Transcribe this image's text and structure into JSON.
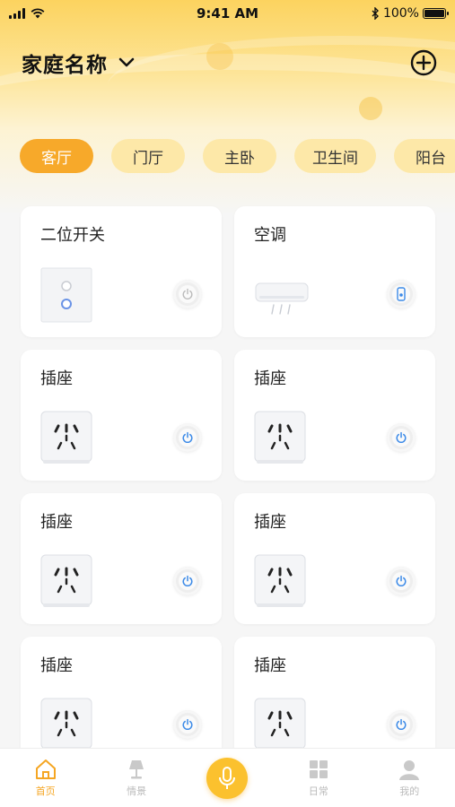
{
  "status_bar": {
    "time": "9:41 AM",
    "battery": "100%"
  },
  "header": {
    "home_name": "家庭名称"
  },
  "rooms": [
    "客厅",
    "门厅",
    "主卧",
    "卫生间",
    "阳台"
  ],
  "devices": [
    {
      "name": "二位开关",
      "type": "switch"
    },
    {
      "name": "空调",
      "type": "ac"
    },
    {
      "name": "插座",
      "type": "socket"
    },
    {
      "name": "插座",
      "type": "socket"
    },
    {
      "name": "插座",
      "type": "socket"
    },
    {
      "name": "插座",
      "type": "socket"
    },
    {
      "name": "插座",
      "type": "socket"
    },
    {
      "name": "插座",
      "type": "socket"
    }
  ],
  "tabbar": {
    "home": "首页",
    "scene": "情景",
    "daily": "日常",
    "mine": "我的"
  },
  "colors": {
    "accent": "#f7a92a",
    "tab_bg": "#fde8a8",
    "power_blue": "#3d8be8"
  }
}
